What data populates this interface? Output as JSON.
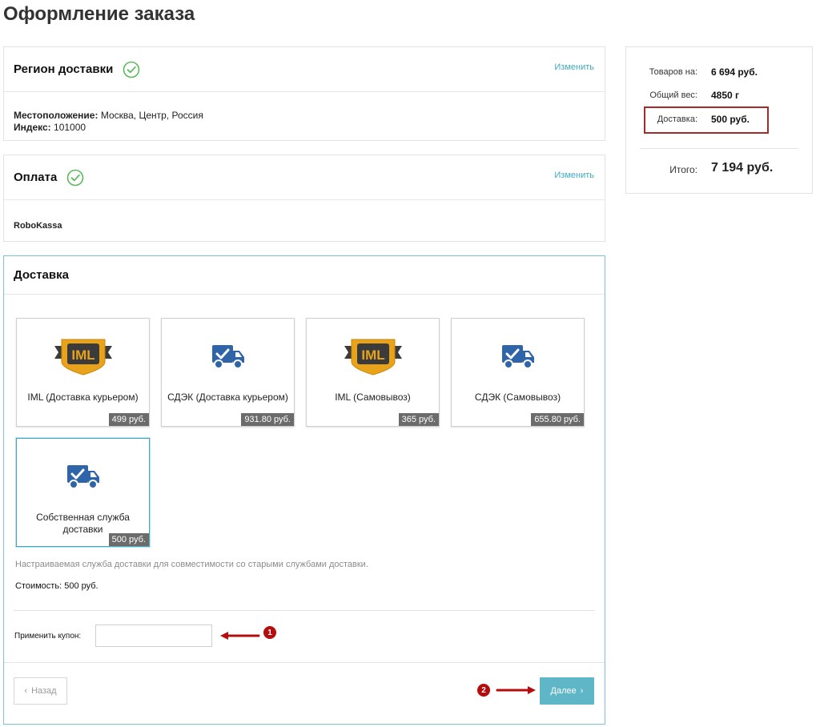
{
  "page": {
    "title": "Оформление заказа"
  },
  "region": {
    "title": "Регион доставки",
    "edit_label": "Изменить",
    "location_label": "Местоположение:",
    "location_value": "Москва, Центр, Россия",
    "index_label": "Индекс:",
    "index_value": "101000"
  },
  "payment": {
    "title": "Оплата",
    "edit_label": "Изменить",
    "method": "RoboKassa"
  },
  "delivery": {
    "title": "Доставка",
    "options": [
      {
        "name": "IML (Доставка курьером)",
        "price": "499 руб.",
        "logo": "iml-logo"
      },
      {
        "name": "СДЭК (Доставка курьером)",
        "price": "931.80 руб.",
        "logo": "truck-check-icon"
      },
      {
        "name": "IML (Самовывоз)",
        "price": "365 руб.",
        "logo": "iml-logo"
      },
      {
        "name": "СДЭК (Самовывоз)",
        "price": "655.80 руб.",
        "logo": "truck-check-icon"
      },
      {
        "name": "Собственная служба доставки",
        "price": "500 руб.",
        "logo": "truck-check-icon",
        "selected": true
      }
    ],
    "description": "Настраиваемая служба доставки для совместимости со старыми службами доставки.",
    "cost_label": "Стоимость:",
    "cost_value": "500 руб.",
    "coupon_label": "Применить купон:",
    "coupon_value": "",
    "back_label": "Назад",
    "next_label": "Далее"
  },
  "annotations": {
    "badge1": "1",
    "badge2": "2",
    "color": "#b40d0d"
  },
  "summary": {
    "goods_label": "Товаров на:",
    "goods_value": "6 694 руб.",
    "weight_label": "Общий вес:",
    "weight_value": "4850 г",
    "delivery_label": "Доставка:",
    "delivery_value": "500 руб.",
    "total_label": "Итого:",
    "total_value": "7 194 руб."
  },
  "colors": {
    "accent": "#3fa9bd",
    "button": "#5fb6c6",
    "success": "#5cb85c",
    "highlight_border": "#a52a2a"
  }
}
